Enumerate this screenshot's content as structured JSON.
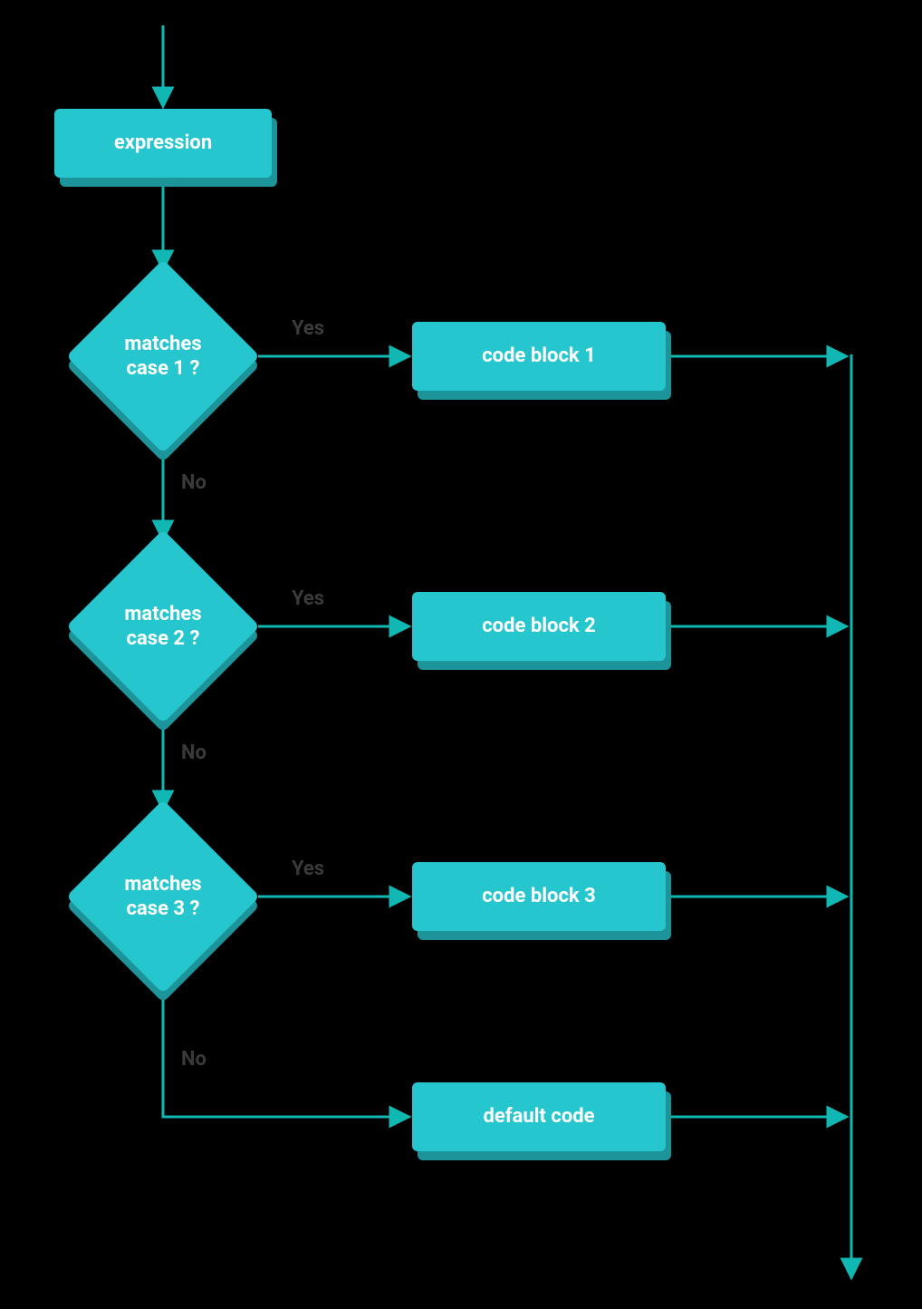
{
  "colors": {
    "node_fill": "#25C6CE",
    "node_shadow": "#1C949A",
    "edge": "#11B7B2",
    "label": "#3A3A3A"
  },
  "start": {
    "label": "expression"
  },
  "cases": [
    {
      "question": "matches\ncase 1 ?",
      "yes_label": "Yes",
      "no_label": "No",
      "block": "code block 1"
    },
    {
      "question": "matches\ncase 2 ?",
      "yes_label": "Yes",
      "no_label": "No",
      "block": "code block 2"
    },
    {
      "question": "matches\ncase 3 ?",
      "yes_label": "Yes",
      "no_label": "No",
      "block": "code block 3"
    }
  ],
  "default_block": "default code"
}
